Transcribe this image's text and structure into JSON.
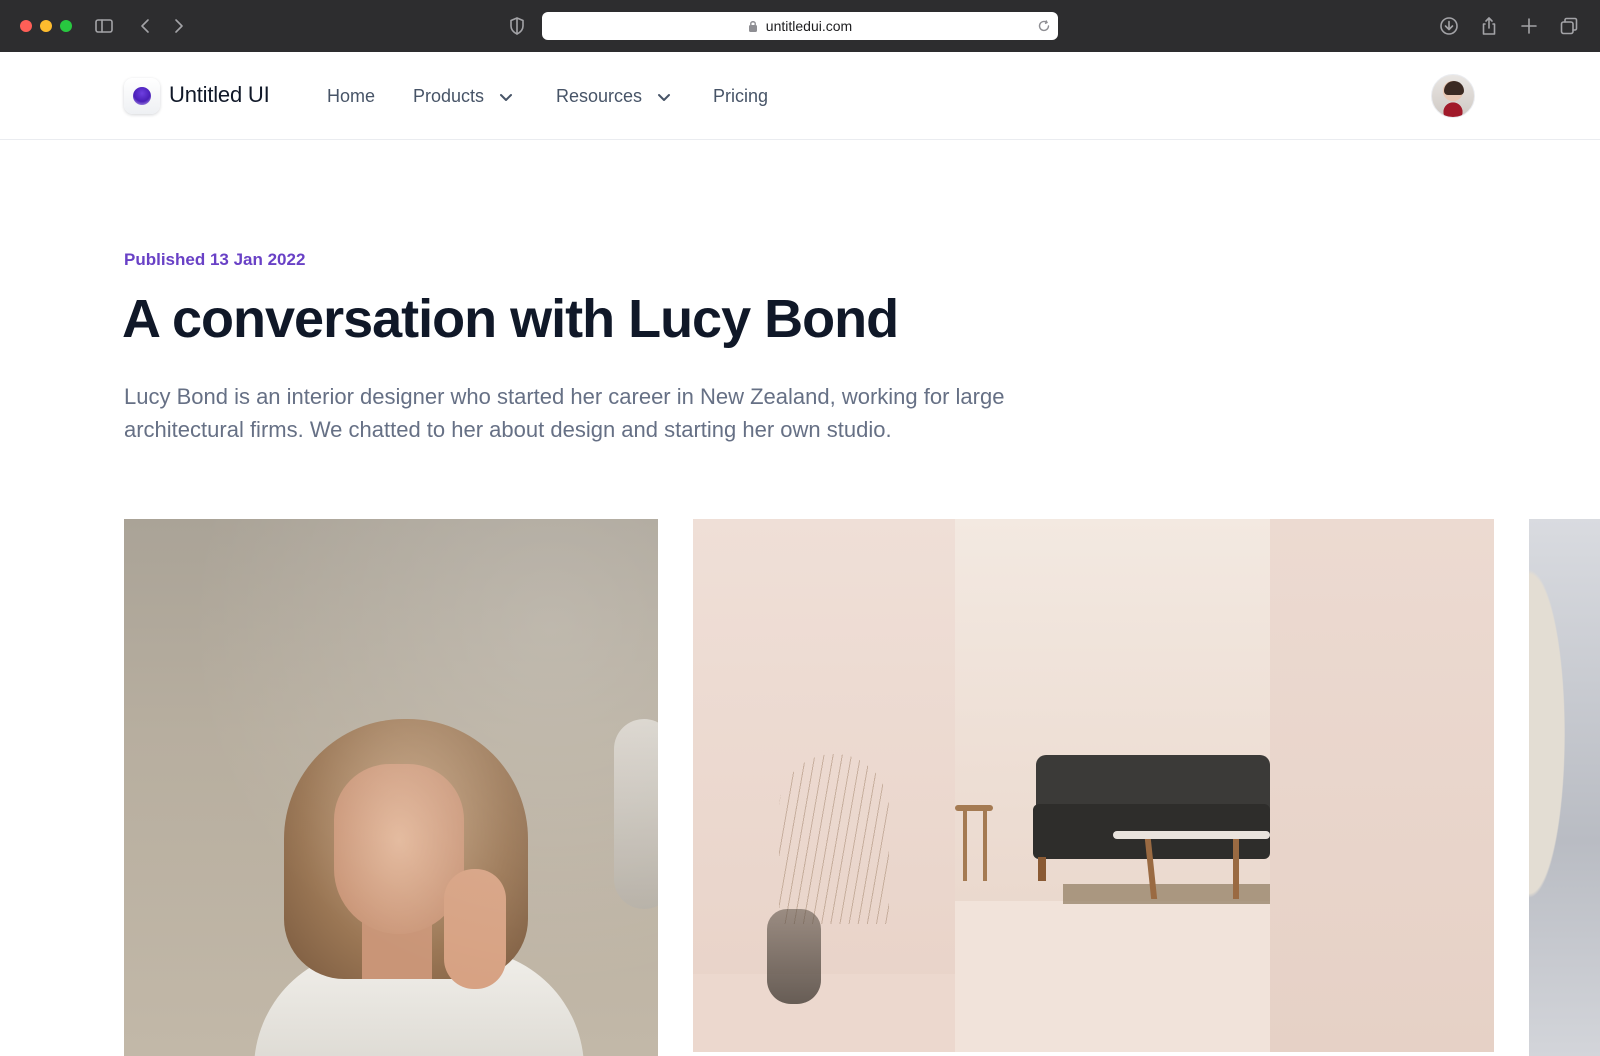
{
  "browser": {
    "url": "untitledui.com"
  },
  "header": {
    "logo_text": "Untitled UI",
    "nav": [
      {
        "label": "Home",
        "has_dropdown": false
      },
      {
        "label": "Products",
        "has_dropdown": true
      },
      {
        "label": "Resources",
        "has_dropdown": true
      },
      {
        "label": "Pricing",
        "has_dropdown": false
      }
    ]
  },
  "article": {
    "published": "Published 13 Jan 2022",
    "title": "A conversation with Lucy Bond",
    "lead": "Lucy Bond is an interior designer who started her career in New Zealand, working for large architectural firms. We chatted to her about design and starting her own studio."
  },
  "colors": {
    "accent": "#6941c6",
    "heading": "#101828",
    "body": "#667085"
  },
  "icons": {
    "sidebar": "sidebar-icon",
    "back": "chevron-left-icon",
    "forward": "chevron-right-icon",
    "shield": "shield-icon",
    "lock": "lock-icon",
    "reload": "reload-icon",
    "download": "download-icon",
    "share": "share-icon",
    "new_tab": "plus-icon",
    "tabs": "tabs-icon",
    "dropdown": "chevron-down-icon"
  }
}
